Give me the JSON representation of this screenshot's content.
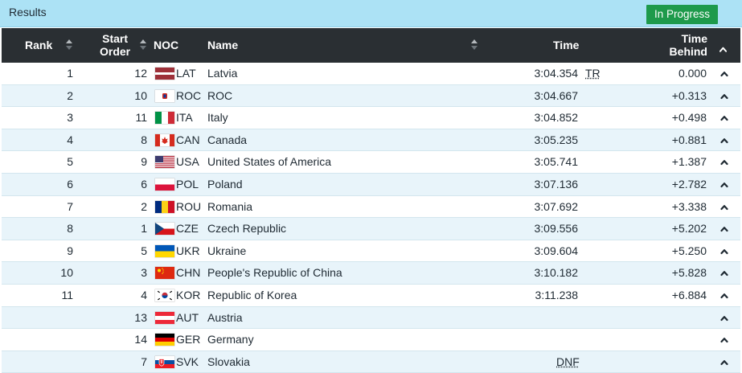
{
  "header": {
    "title": "Results",
    "status_badge": "In Progress"
  },
  "table": {
    "columns": {
      "rank": "Rank",
      "start_order": [
        "Start",
        "Order"
      ],
      "noc": "NOC",
      "name": "Name",
      "time": "Time",
      "time_behind": [
        "Time",
        "Behind"
      ]
    },
    "rows": [
      {
        "rank": "1",
        "start": "12",
        "noc": "LAT",
        "name": "Latvia",
        "time": "3:04.354",
        "note": "TR",
        "behind": "0.000",
        "flag": "lat"
      },
      {
        "rank": "2",
        "start": "10",
        "noc": "ROC",
        "name": "ROC",
        "time": "3:04.667",
        "note": "",
        "behind": "+0.313",
        "flag": "roc"
      },
      {
        "rank": "3",
        "start": "11",
        "noc": "ITA",
        "name": "Italy",
        "time": "3:04.852",
        "note": "",
        "behind": "+0.498",
        "flag": "ita"
      },
      {
        "rank": "4",
        "start": "8",
        "noc": "CAN",
        "name": "Canada",
        "time": "3:05.235",
        "note": "",
        "behind": "+0.881",
        "flag": "can"
      },
      {
        "rank": "5",
        "start": "9",
        "noc": "USA",
        "name": "United States of America",
        "time": "3:05.741",
        "note": "",
        "behind": "+1.387",
        "flag": "usa"
      },
      {
        "rank": "6",
        "start": "6",
        "noc": "POL",
        "name": "Poland",
        "time": "3:07.136",
        "note": "",
        "behind": "+2.782",
        "flag": "pol"
      },
      {
        "rank": "7",
        "start": "2",
        "noc": "ROU",
        "name": "Romania",
        "time": "3:07.692",
        "note": "",
        "behind": "+3.338",
        "flag": "rou"
      },
      {
        "rank": "8",
        "start": "1",
        "noc": "CZE",
        "name": "Czech Republic",
        "time": "3:09.556",
        "note": "",
        "behind": "+5.202",
        "flag": "cze"
      },
      {
        "rank": "9",
        "start": "5",
        "noc": "UKR",
        "name": "Ukraine",
        "time": "3:09.604",
        "note": "",
        "behind": "+5.250",
        "flag": "ukr"
      },
      {
        "rank": "10",
        "start": "3",
        "noc": "CHN",
        "name": "People's Republic of China",
        "time": "3:10.182",
        "note": "",
        "behind": "+5.828",
        "flag": "chn"
      },
      {
        "rank": "11",
        "start": "4",
        "noc": "KOR",
        "name": "Republic of Korea",
        "time": "3:11.238",
        "note": "",
        "behind": "+6.884",
        "flag": "kor"
      },
      {
        "rank": "",
        "start": "13",
        "noc": "AUT",
        "name": "Austria",
        "time": "",
        "note": "",
        "behind": "",
        "flag": "aut"
      },
      {
        "rank": "",
        "start": "14",
        "noc": "GER",
        "name": "Germany",
        "time": "",
        "note": "",
        "behind": "",
        "flag": "ger"
      },
      {
        "rank": "",
        "start": "7",
        "noc": "SVK",
        "name": "Slovakia",
        "time": "",
        "note": "DNF",
        "behind": "",
        "flag": "svk"
      }
    ]
  },
  "colors": {
    "header_bar": "#ace2f5",
    "badge": "#1e9a4b",
    "table_head": "#2a2f33",
    "row_alt": "#e8f4fa"
  },
  "icons": {
    "sort": "sort-arrows-icon",
    "expand": "chevron-up-icon"
  }
}
